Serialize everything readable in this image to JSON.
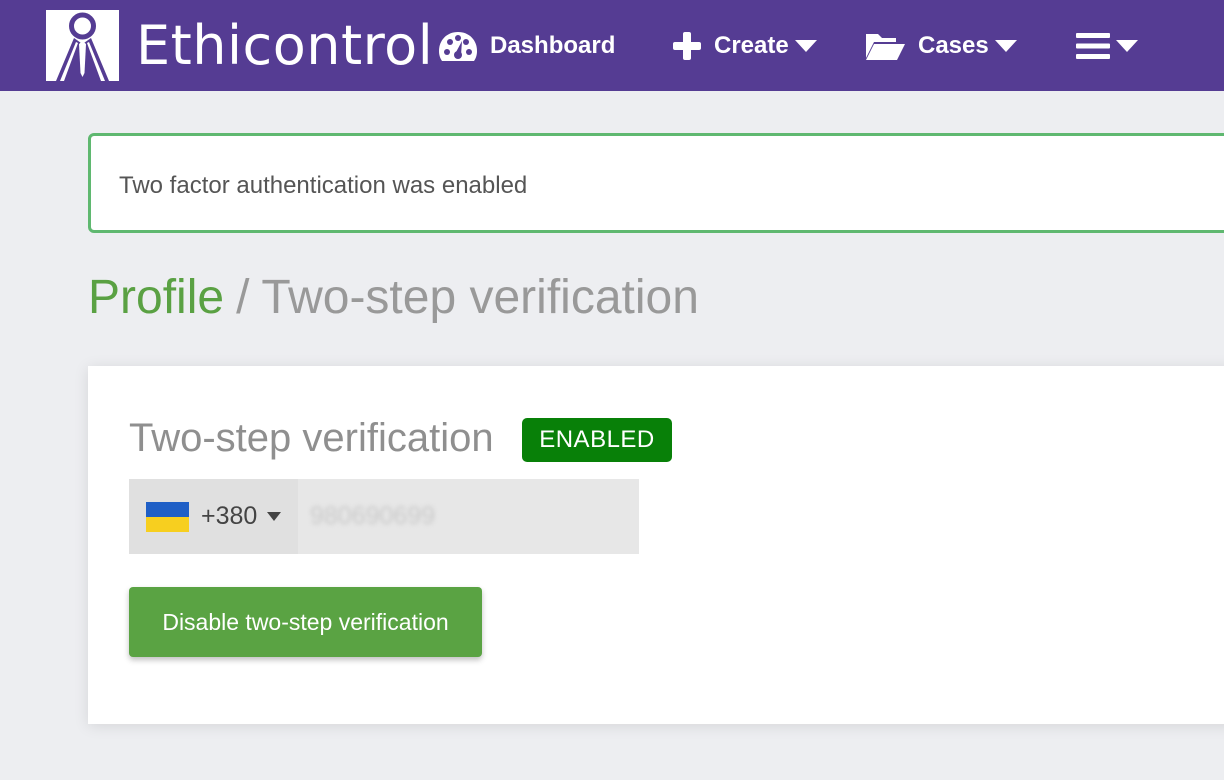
{
  "navbar": {
    "brand": "Ethicontrol",
    "items": [
      {
        "label": "Dashboard",
        "icon": "dashboard-gauge-icon"
      },
      {
        "label": "Create",
        "icon": "plus-icon",
        "dropdown": true
      },
      {
        "label": "Cases",
        "icon": "folder-open-icon",
        "dropdown": true
      },
      {
        "label": "",
        "icon": "hamburger-menu-icon",
        "dropdown": true
      }
    ],
    "background_color": "#553c93"
  },
  "alert": {
    "message": "Two factor authentication was enabled",
    "border_color": "#5fb870"
  },
  "breadcrumb": {
    "link": "Profile",
    "separator": "/",
    "current": "Two-step verification"
  },
  "card": {
    "title": "Two-step verification",
    "status_badge": "ENABLED",
    "badge_color": "#088008",
    "phone": {
      "country_flag": "ukraine-flag-icon",
      "dial_code": "+380",
      "number": "980690699"
    },
    "disable_button_label": "Disable two-step verification",
    "button_color": "#5aa343"
  }
}
